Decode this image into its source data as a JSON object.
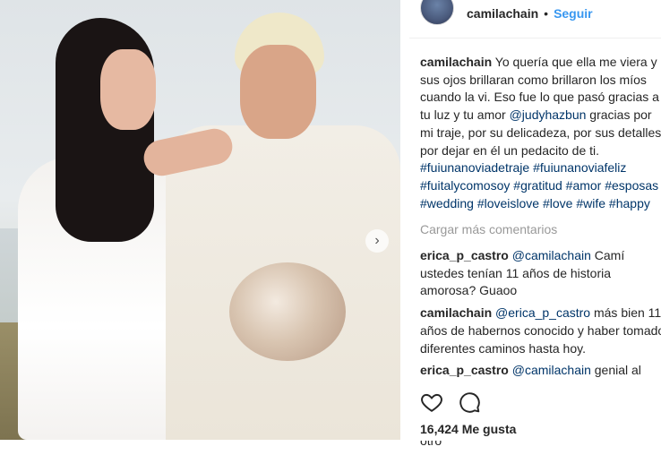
{
  "post": {
    "username": "camilachain",
    "separator": "•",
    "follow_label": "Seguir",
    "caption": {
      "username": "camilachain",
      "text_1": " Yo quería que ella me viera y sus ojos brillaran como brillaron los míos cuando la vi. Eso fue lo que pasó gracias a tu luz y tu amor ",
      "mention": "@judyhazbun",
      "text_2": " gracias por mi traje, por su delicadeza, por sus detalles, por dejar en él un pedacito de ti. ",
      "tags": [
        "#fuiunanoviadetraje",
        "#fuiunanoviafeliz",
        "#fuitalycomosoy",
        "#gratitud",
        "#amor",
        "#esposas",
        "#wedding",
        "#loveislove",
        "#love",
        "#wife",
        "#happy"
      ]
    },
    "load_more_label": "Cargar más comentarios",
    "comments": [
      {
        "username": "erica_p_castro",
        "mention": "@camilachain",
        "text": " Camí ustedes tenían 11 años de historia amorosa? Guaoo"
      },
      {
        "username": "camilachain",
        "mention": "@erica_p_castro",
        "text": " más bien 11 años de habernos conocido y haber tomado diferentes caminos hasta hoy."
      },
      {
        "username": "erica_p_castro",
        "mention": "@camilachain",
        "text": " genial al final de conocer otros mundos en otros seres descubrieron que estaban echas la una para la otra , cosa de locos, eres de otro"
      }
    ],
    "likes_label": "16,424 Me gusta"
  },
  "icons": {
    "like": "heart-icon",
    "comment": "comment-icon",
    "carousel_next": "chevron-right-icon"
  },
  "colors": {
    "link": "#003569",
    "follow": "#3897f0",
    "muted": "#999999"
  }
}
